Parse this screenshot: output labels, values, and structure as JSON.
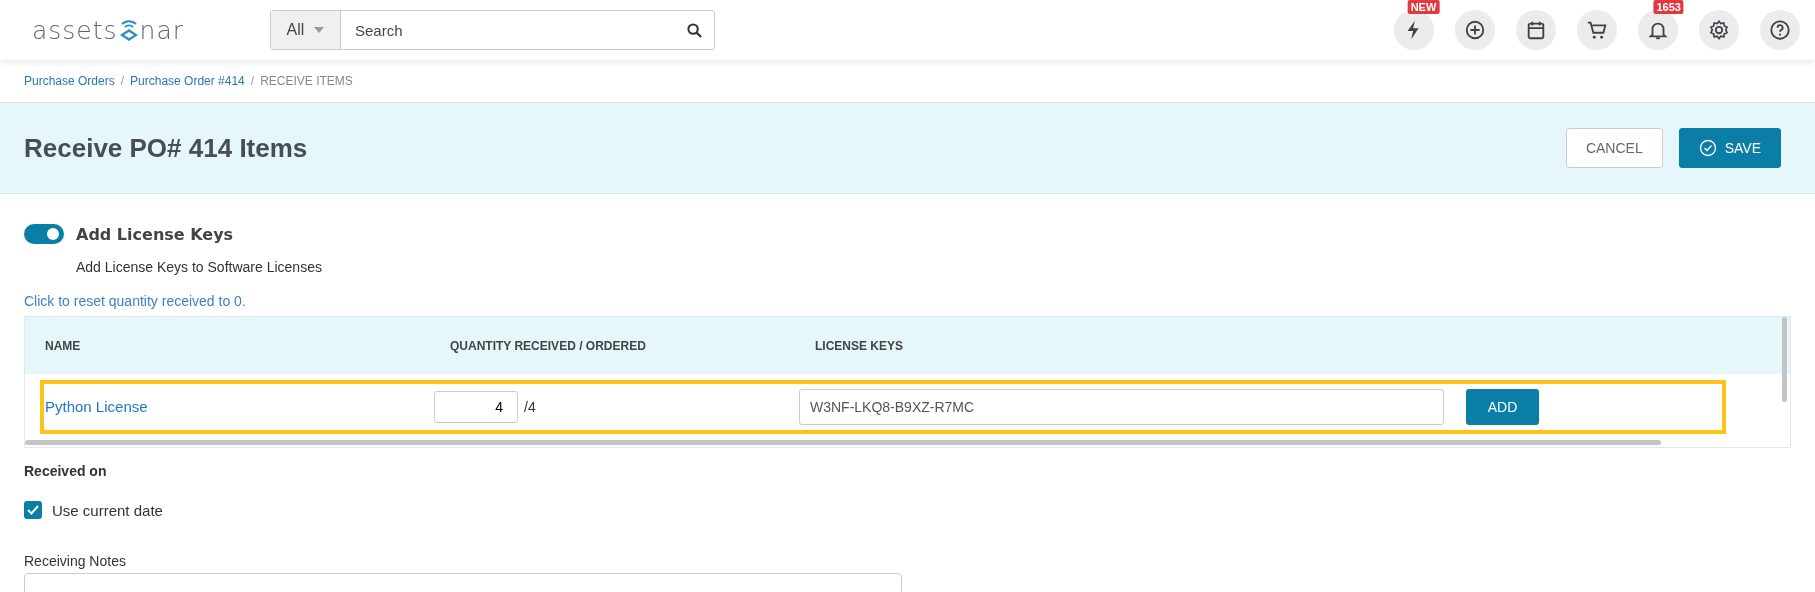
{
  "header": {
    "logo": {
      "before": "assets",
      "after": "nar"
    },
    "search": {
      "scope": "All",
      "placeholder": "Search"
    },
    "icons": [
      {
        "kind": "bolt",
        "badge": "NEW"
      },
      {
        "kind": "plus"
      },
      {
        "kind": "calendar"
      },
      {
        "kind": "cart"
      },
      {
        "kind": "bell",
        "badge": "1653"
      },
      {
        "kind": "gear"
      },
      {
        "kind": "help"
      }
    ]
  },
  "breadcrumb": [
    {
      "label": "Purchase Orders",
      "link": true
    },
    {
      "separator": "/",
      "label": "Purchase Order #414",
      "link": true
    },
    {
      "separator": "/",
      "label": "RECEIVE ITEMS",
      "link": false
    }
  ],
  "page": {
    "title": "Receive PO# 414 Items",
    "buttons": [
      {
        "label": "CANCEL",
        "kind": "secondary"
      },
      {
        "label": "SAVE",
        "kind": "primary"
      }
    ]
  },
  "license_toggle": {
    "label": "Add License Keys",
    "on": true,
    "description": "Add License Keys to Software Licenses"
  },
  "reset_link": "Click to reset quantity received to 0.",
  "table": {
    "columns": [
      "NAME",
      "QUANTITY RECEIVED / ORDERED",
      "LICENSE KEYS"
    ],
    "rows": [
      {
        "name": "Python License",
        "quantity": "4",
        "ordered": "/4",
        "license_key": "W3NF-LKQ8-B9XZ-R7MC",
        "button": "ADD",
        "highlighted": true
      }
    ]
  },
  "received_on": {
    "label": "Received on",
    "checkbox": {
      "label": "Use current date",
      "checked": true
    }
  },
  "notes": {
    "label": "Receiving Notes"
  }
}
